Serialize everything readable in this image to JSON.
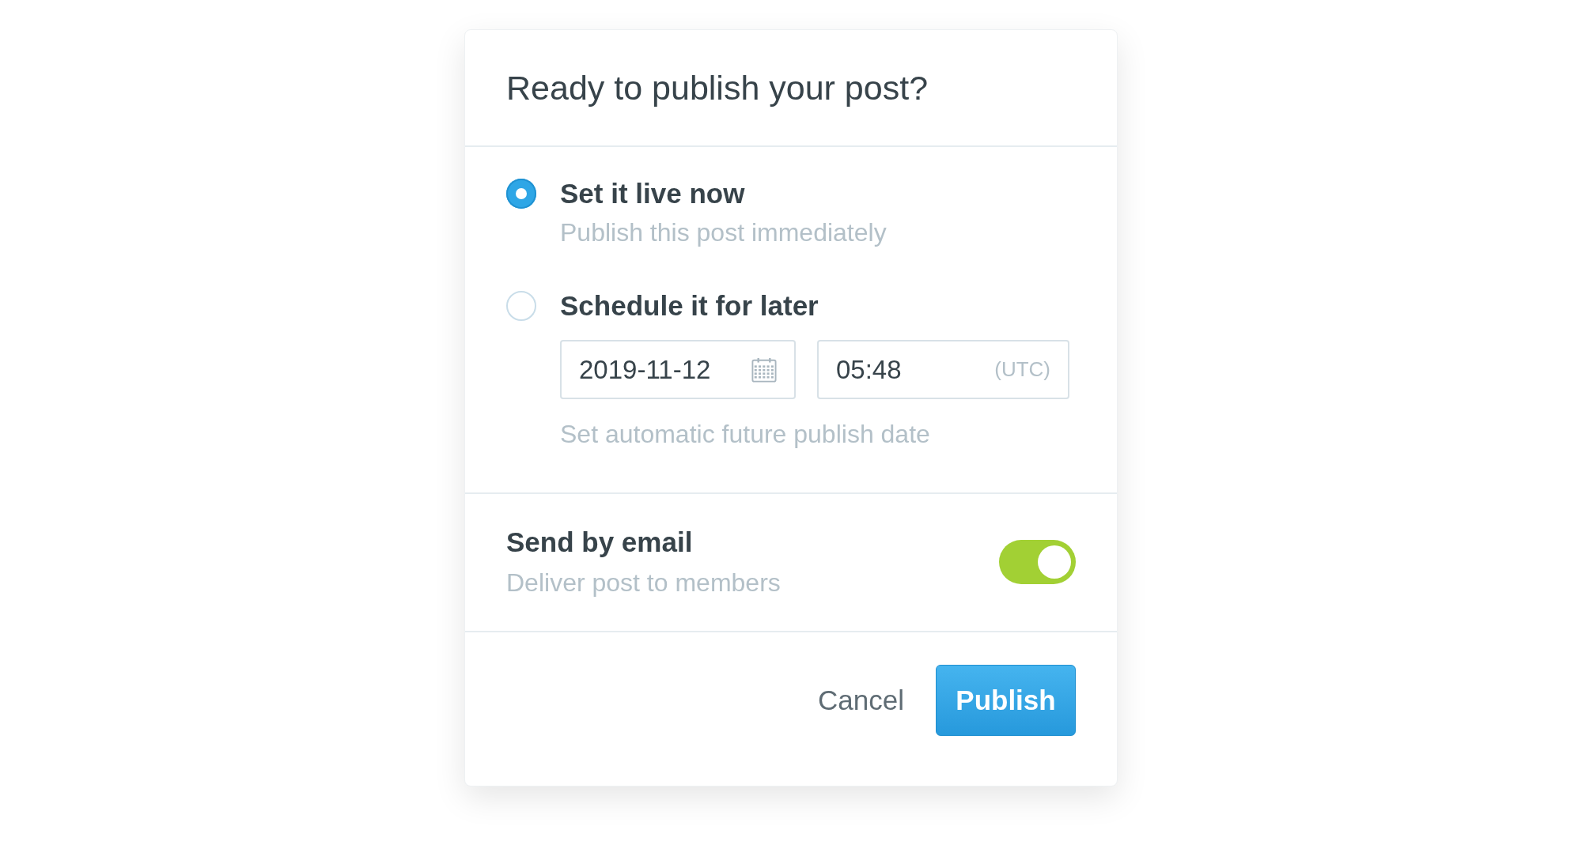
{
  "dialog": {
    "title": "Ready to publish your post?"
  },
  "options": [
    {
      "label": "Set it live now",
      "description": "Publish this post immediately",
      "selected": true
    },
    {
      "label": "Schedule it for later",
      "selected": false
    }
  ],
  "schedule": {
    "date": "2019-11-12",
    "time": "05:48",
    "timezone": "(UTC)",
    "hint": "Set automatic future publish date"
  },
  "email": {
    "label": "Send by email",
    "description": "Deliver post to members",
    "on": true
  },
  "buttons": {
    "cancel": "Cancel",
    "publish": "Publish"
  }
}
